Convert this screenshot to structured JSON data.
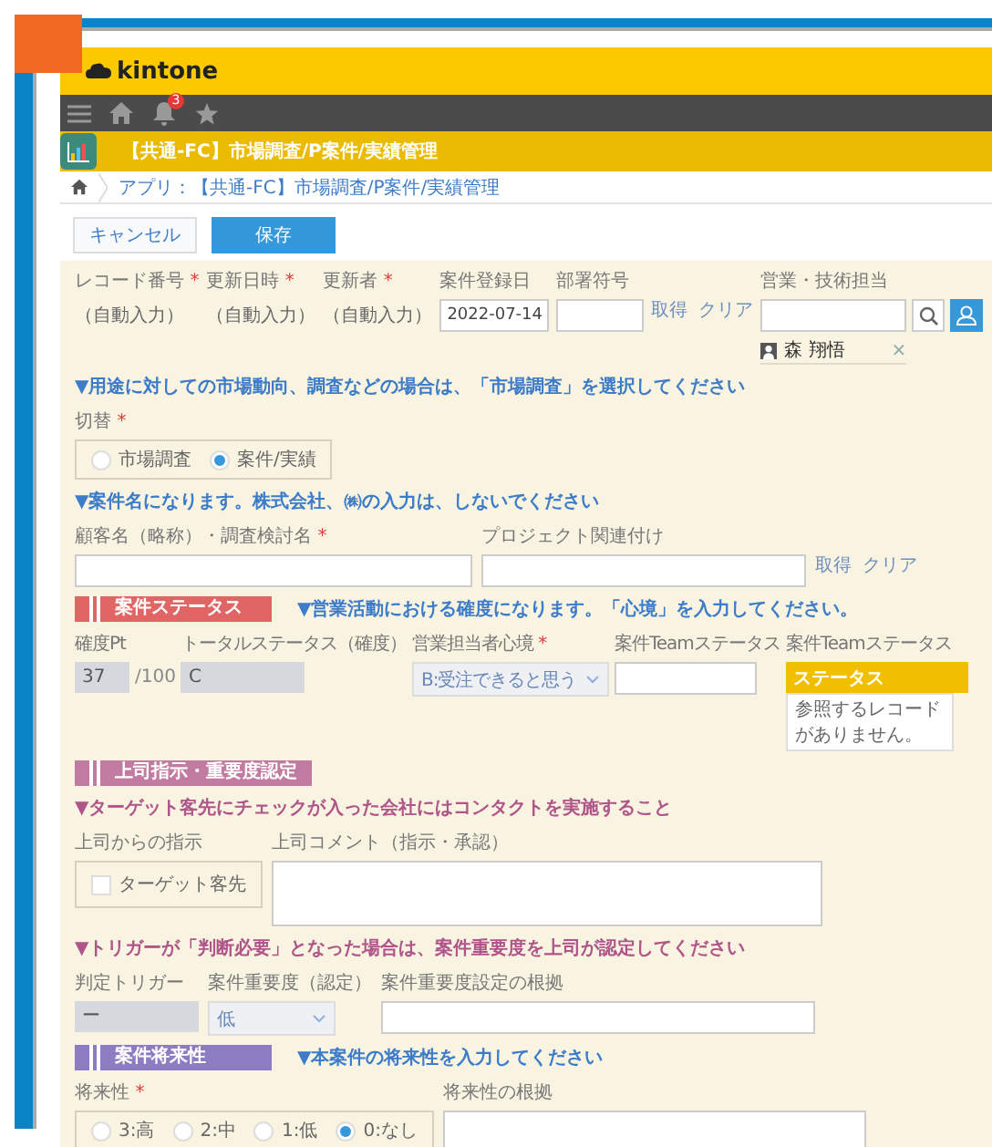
{
  "header": {
    "logo": "kintone",
    "notifications": "3"
  },
  "app": {
    "title": "【共通-FC】市場調査/P案件/実績管理"
  },
  "breadcrumb": {
    "text": "アプリ：【共通-FC】市場調査/P案件/実績管理"
  },
  "buttons": [
    {
      "label": "キャンセル",
      "kind": "secondary"
    },
    {
      "label": "保存",
      "kind": "primary"
    }
  ],
  "rows": [
    {
      "kind": "fields",
      "fields": [
        {
          "kind": "auto",
          "label": "レコード番号",
          "mark": "*",
          "value": "（自動入力）"
        },
        {
          "kind": "auto",
          "label": "更新日時",
          "mark": "*",
          "value": "（自動入力）"
        },
        {
          "kind": "auto",
          "label": "更新者",
          "mark": "*",
          "value": "（自動入力）"
        },
        {
          "kind": "input",
          "label": "案件登録日",
          "value": "2022-07-14"
        },
        {
          "kind": "input",
          "label": "部署符号"
        },
        {
          "kind": "links",
          "links": [
            "取得",
            "クリア"
          ]
        },
        {
          "kind": "user",
          "label": "営業・技術担当",
          "user": "森 翔悟",
          "remove": "×"
        }
      ]
    },
    {
      "kind": "note",
      "text": "▼用途に対しての市場動向、調査などの場合は、「市場調査」を選択してください",
      "color": "#3d7cc9"
    },
    {
      "kind": "fields",
      "fields": [
        {
          "kind": "radio",
          "label": "切替",
          "mark": "*",
          "options": [
            {
              "label": "市場調査",
              "selected": false
            },
            {
              "label": "案件/実績",
              "selected": true
            }
          ]
        }
      ]
    },
    {
      "kind": "note",
      "text": "▼案件名になります。株式会社、㈱の入力は、しないでください",
      "color": "#3d7cc9"
    },
    {
      "kind": "fields",
      "fields": [
        {
          "kind": "input",
          "label": "顧客名（略称）・調査検討名",
          "mark": "*"
        },
        {
          "kind": "input",
          "label": "プロジェクト関連付け"
        },
        {
          "kind": "links",
          "links": [
            "取得",
            "クリア"
          ]
        }
      ]
    },
    {
      "kind": "section",
      "label": "案件ステータス",
      "color": "#e06666",
      "note": {
        "text": "▼営業活動における確度になります。「心境」を入力してください。",
        "color": "#3d7cc9"
      }
    },
    {
      "kind": "fields",
      "fields": [
        {
          "kind": "calc",
          "label": "確度Pt",
          "value": "37",
          "suffix": "/100"
        },
        {
          "kind": "calc",
          "label": "トータルステータス（確度）",
          "value": "C"
        },
        {
          "kind": "select",
          "label": "営業担当者心境",
          "mark": "*",
          "value": "B:受注できると思う"
        },
        {
          "kind": "input",
          "label": "案件Teamステータス"
        },
        {
          "kind": "reference",
          "label": "案件Teamステータス",
          "column": "ステータス",
          "message": "参照するレコードがありません。"
        }
      ]
    },
    {
      "kind": "section",
      "label": "上司指示・重要度認定",
      "color": "#c27ba0"
    },
    {
      "kind": "note",
      "text": "▼ターゲット客先にチェックが入った会社にはコンタクトを実施すること",
      "color": "#b0558a"
    },
    {
      "kind": "fields",
      "fields": [
        {
          "kind": "check",
          "label": "上司からの指示",
          "options": [
            {
              "label": "ターゲット客先",
              "checked": false
            }
          ]
        },
        {
          "kind": "textarea",
          "label": "上司コメント（指示・承認）"
        }
      ]
    },
    {
      "kind": "note",
      "text": "▼トリガーが「判断必要」となった場合は、案件重要度を上司が認定してください",
      "color": "#b0558a"
    },
    {
      "kind": "fields",
      "fields": [
        {
          "kind": "calc",
          "label": "判定トリガー",
          "value": "ー"
        },
        {
          "kind": "select",
          "label": "案件重要度（認定）",
          "value": "低"
        },
        {
          "kind": "input",
          "label": "案件重要度設定の根拠"
        }
      ]
    },
    {
      "kind": "section",
      "label": "案件将来性",
      "color": "#8e7cc3",
      "note": {
        "text": "▼本案件の将来性を入力してください",
        "color": "#3d7cc9"
      }
    },
    {
      "kind": "fields",
      "fields": [
        {
          "kind": "radio",
          "label": "将来性",
          "mark": "*",
          "options": [
            {
              "label": "3:高",
              "selected": false
            },
            {
              "label": "2:中",
              "selected": false
            },
            {
              "label": "1:低",
              "selected": false
            },
            {
              "label": "0:なし",
              "selected": true
            }
          ]
        },
        {
          "kind": "textarea",
          "label": "将来性の根拠"
        }
      ]
    }
  ]
}
